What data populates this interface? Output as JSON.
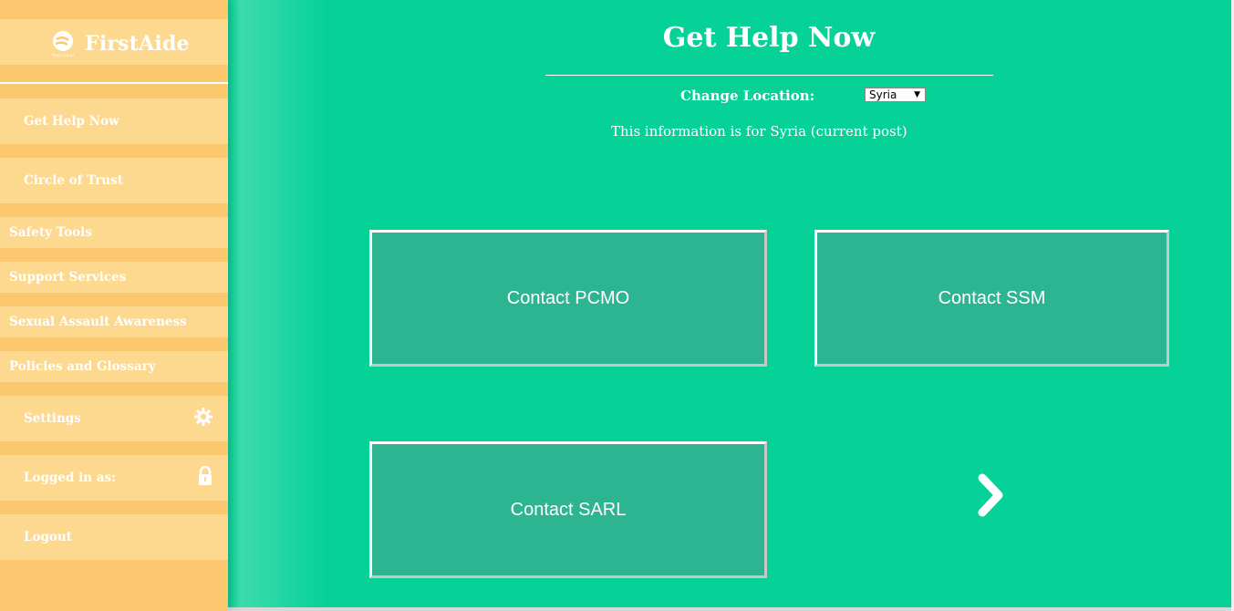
{
  "app": {
    "name": "FirstAide",
    "logo_caption": "Peace Corps"
  },
  "sidebar": {
    "items": [
      {
        "label": "Get Help Now"
      },
      {
        "label": "Circle of Trust"
      },
      {
        "label": "Safety Tools"
      },
      {
        "label": "Support Services"
      },
      {
        "label": "Sexual Assault Awareness"
      },
      {
        "label": "Policies and Glossary"
      },
      {
        "label": "Settings",
        "icon": "gear-icon"
      },
      {
        "label": "Logged in as:",
        "icon": "lock-icon"
      },
      {
        "label": "Logout"
      }
    ]
  },
  "main": {
    "title": "Get Help Now",
    "location_label": "Change Location:",
    "location_value": "Syria",
    "info_text": "This information is for Syria (current post)",
    "tiles": [
      {
        "label": "Contact PCMO"
      },
      {
        "label": "Contact SSM"
      },
      {
        "label": "Contact SARL"
      }
    ],
    "next_icon": "chevron-right-icon"
  },
  "colors": {
    "sidebar_bg": "#fbc86f",
    "sidebar_item_bg": "#fdd88f",
    "main_bg": "#06d197",
    "tile_bg": "#2db591"
  }
}
